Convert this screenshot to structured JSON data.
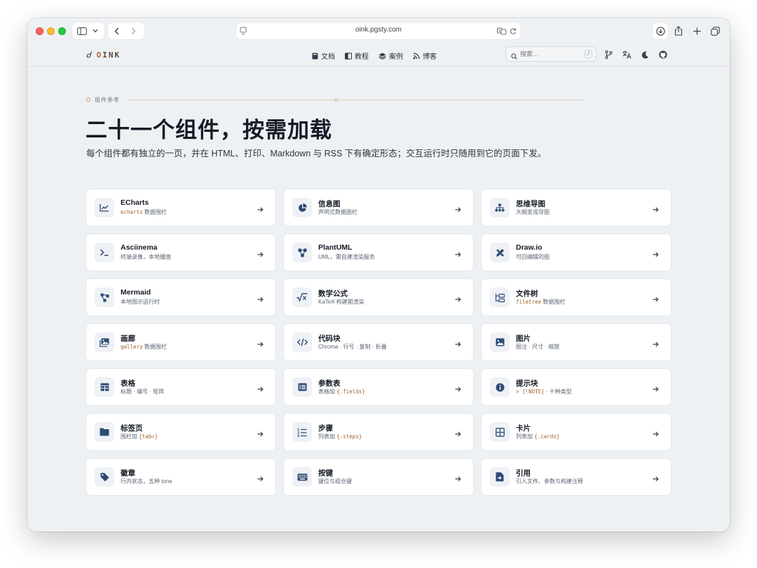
{
  "browser": {
    "url": "oink.pgsty.com"
  },
  "site": {
    "logo_text": "OINK",
    "nav": [
      {
        "label": "文档",
        "icon": "book-icon"
      },
      {
        "label": "教程",
        "icon": "book-open-icon"
      },
      {
        "label": "案例",
        "icon": "layers-icon"
      },
      {
        "label": "博客",
        "icon": "rss-icon"
      }
    ],
    "search_placeholder": "搜索...",
    "search_shortcut": "/"
  },
  "hero": {
    "eyebrow": "组件参考",
    "title": "二十一个组件，按需加载",
    "subtitle": "每个组件都有独立的一页，并在 HTML、打印、Markdown 与 RSS 下有确定形态；交互运行时只随用到它的页面下发。"
  },
  "components": [
    {
      "title": "ECharts",
      "code": "echarts",
      "desc": " 数据围栏",
      "icon": "line-chart-icon"
    },
    {
      "title": "信息图",
      "code": "",
      "desc": "声明式数据图栏",
      "icon": "pie-chart-icon"
    },
    {
      "title": "思维导图",
      "code": "",
      "desc": "大纲变成导图",
      "icon": "sitemap-icon"
    },
    {
      "title": "Asciinema",
      "code": "",
      "desc": "终端录像，本地播放",
      "icon": "terminal-icon"
    },
    {
      "title": "PlantUML",
      "code": "",
      "desc": "UML，需自建渲染服务",
      "icon": "diagram-icon"
    },
    {
      "title": "Draw.io",
      "code": "",
      "desc": "可回编辑的图",
      "icon": "pen-ruler-icon"
    },
    {
      "title": "Mermaid",
      "code": "",
      "desc": "本地图示运行时",
      "icon": "flow-icon"
    },
    {
      "title": "数学公式",
      "code": "",
      "desc": "KaTeX 构建期渲染",
      "icon": "sqrt-icon"
    },
    {
      "title": "文件树",
      "code": "filetree",
      "desc": " 数据围栏",
      "icon": "folder-tree-icon"
    },
    {
      "title": "画廊",
      "code": "gallery",
      "desc": " 数据围栏",
      "icon": "images-icon"
    },
    {
      "title": "代码块",
      "code": "",
      "desc": "Chroma · 行号 · 复制 · 折叠",
      "icon": "code-icon"
    },
    {
      "title": "图片",
      "code": "",
      "desc": "图注 · 尺寸 · 缩放",
      "icon": "image-icon"
    },
    {
      "title": "表格",
      "code": "",
      "desc": "标题 · 编号 · 矩阵",
      "icon": "table-icon"
    },
    {
      "title": "参数表",
      "code": "{.fields}",
      "desc": "表格加 ",
      "code_after": true,
      "icon": "list-table-icon"
    },
    {
      "title": "提示块",
      "code": "> [!NOTE]",
      "desc": " · 十种类型",
      "icon": "info-icon"
    },
    {
      "title": "标签页",
      "code": "{tab=}",
      "desc": "围栏加 ",
      "code_after": true,
      "icon": "folder-icon"
    },
    {
      "title": "步骤",
      "code": "{.steps}",
      "desc": "列表加 ",
      "code_after": true,
      "icon": "list-ol-icon"
    },
    {
      "title": "卡片",
      "code": "{.cards}",
      "desc": "列表加 ",
      "code_after": true,
      "icon": "grid-icon"
    },
    {
      "title": "徽章",
      "code": "",
      "desc": "行内状态，五种 tone",
      "icon": "tag-icon"
    },
    {
      "title": "按键",
      "code": "",
      "desc": "键位与组合键",
      "icon": "keyboard-icon"
    },
    {
      "title": "引用",
      "code": "",
      "desc": "引入文件、参数与构建注释",
      "icon": "file-import-icon"
    }
  ]
}
